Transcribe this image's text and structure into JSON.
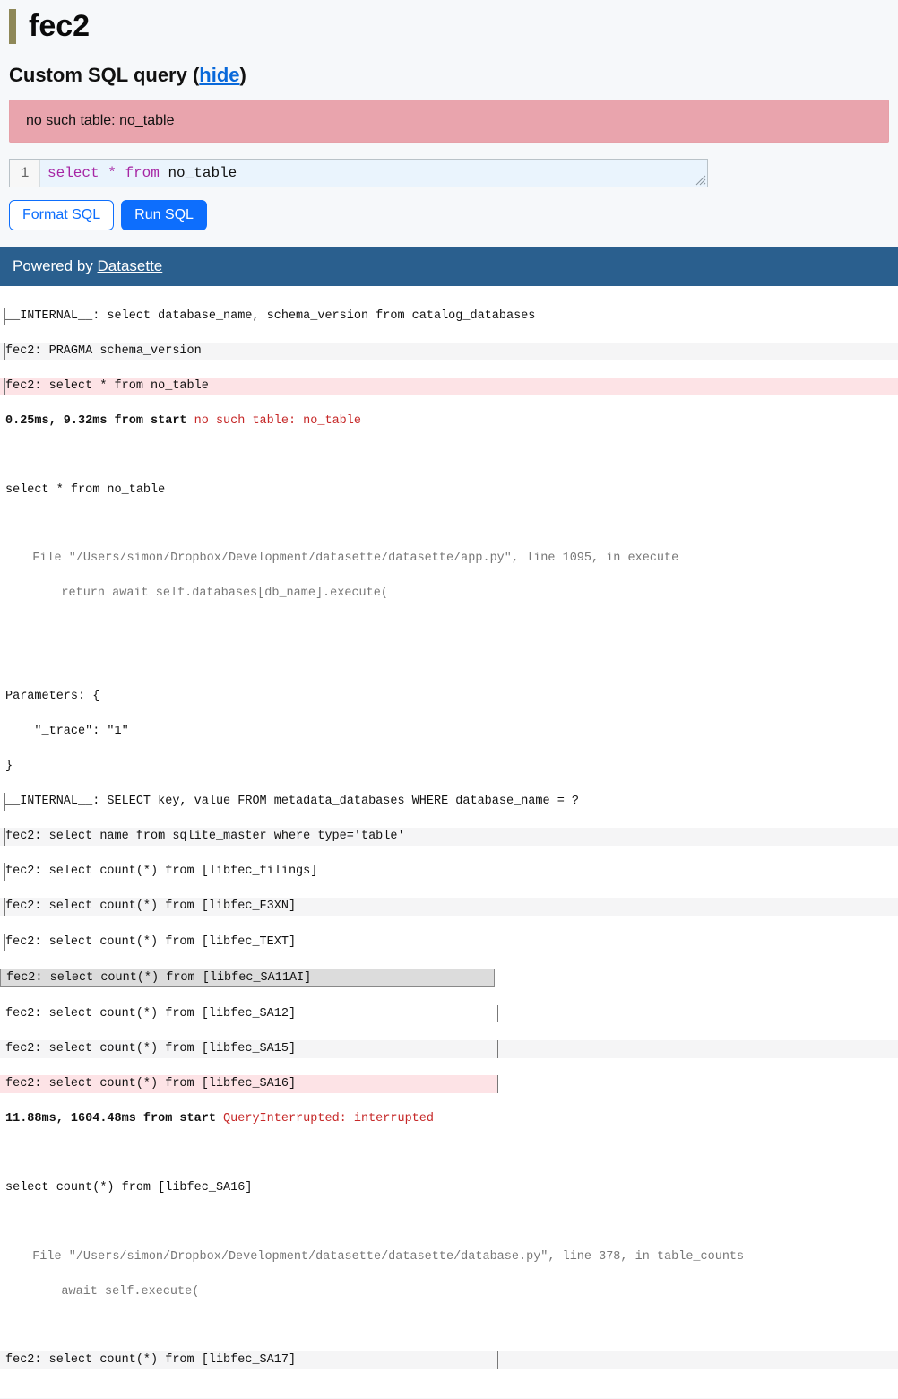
{
  "page_title": "fec2",
  "subtitle_prefix": "Custom SQL query (",
  "subtitle_link": "hide",
  "subtitle_suffix": ")",
  "error_message": "no such table: no_table",
  "editor": {
    "line_number": "1",
    "kw_select": "select",
    "star": "*",
    "kw_from": "from",
    "ident": "no_table"
  },
  "buttons": {
    "format": "Format SQL",
    "run": "Run SQL"
  },
  "footer": {
    "prefix": "Powered by ",
    "link": "Datasette"
  },
  "trace": {
    "r0": "__INTERNAL__: select database_name, schema_version from catalog_databases",
    "r1": "fec2: PRAGMA schema_version",
    "r2": "fec2: select * from no_table",
    "r3a": "0.25ms, 9.32ms from start ",
    "r3b": "no such table: no_table",
    "r4": "select * from no_table",
    "r5": "  File \"/Users/simon/Dropbox/Development/datasette/datasette/app.py\", line 1095, in execute",
    "r6": "    return await self.databases[db_name].execute(",
    "r7": "Parameters: {",
    "r8": "    \"_trace\": \"1\"",
    "r9": "}",
    "r10": "__INTERNAL__: SELECT key, value FROM metadata_databases WHERE database_name = ?",
    "r11": "fec2: select name from sqlite_master where type='table'",
    "r12": "fec2: select count(*) from [libfec_filings]",
    "r13": "fec2: select count(*) from [libfec_F3XN]",
    "r14": "fec2: select count(*) from [libfec_TEXT]",
    "r15": "fec2: select count(*) from [libfec_SA11AI]",
    "r16": "fec2: select count(*) from [libfec_SA12]",
    "r17": "fec2: select count(*) from [libfec_SA15]",
    "r18": "fec2: select count(*) from [libfec_SA16]",
    "r19a": "11.88ms, 1604.48ms from start ",
    "r19b": "QueryInterrupted: interrupted",
    "r20": "select count(*) from [libfec_SA16]",
    "r21": "  File \"/Users/simon/Dropbox/Development/datasette/datasette/database.py\", line 378, in table_counts",
    "r22": "    await self.execute(",
    "r23": "fec2: select count(*) from [libfec_SA17]"
  }
}
